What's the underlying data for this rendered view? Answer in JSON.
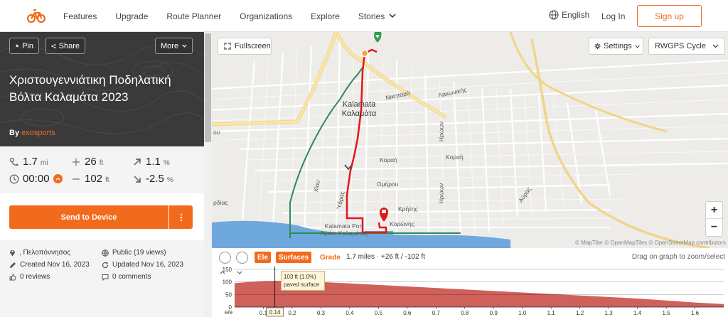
{
  "nav": {
    "links": [
      "Features",
      "Upgrade",
      "Route Planner",
      "Organizations",
      "Explore",
      "Stories"
    ],
    "language": "English",
    "login": "Log In",
    "signup": "Sign up",
    "accent": "#f26b1d"
  },
  "route": {
    "pin_label": "Pin",
    "share_label": "Share",
    "more_label": "More",
    "title": "Χριστουγεννιάτικη Ποδηλατική Βόλτα Καλαμάτα 2023",
    "by_label": "By",
    "author": "exosports"
  },
  "stats": {
    "distance": {
      "value": "1.7",
      "unit": "mi"
    },
    "elev_gain": {
      "value": "26",
      "unit": "ft"
    },
    "grade_up": {
      "value": "1.1",
      "unit": "%"
    },
    "time": {
      "value": "00:00"
    },
    "elev_loss": {
      "value": "102",
      "unit": "ft"
    },
    "grade_down": {
      "value": "-2.5",
      "unit": "%"
    }
  },
  "actions": {
    "send_to_device": "Send to Device"
  },
  "meta": {
    "location": ", Πελοπόννησος",
    "visibility": "Public (19 views)",
    "created": "Created Nov 16, 2023",
    "updated": "Updated Nov 16, 2023",
    "reviews": "0 reviews",
    "comments": "0 comments"
  },
  "map": {
    "fullscreen_label": "Fullscreen",
    "settings_label": "Settings",
    "map_style": "RWGPS Cycle",
    "zoom_in": "+",
    "zoom_out": "−",
    "attribution": "© MapTiler © OpenMapTiles © OpenStreetMap contributors",
    "labels": {
      "city": "Kalamata\nΚαλαμάτα",
      "nikitara": "Νικηταρά",
      "lakonikis": "Λακωνικής",
      "korai": "Κοραή",
      "korai2": "Κοραή",
      "omirou": "Ομήρου",
      "kritis": "Κρήτης",
      "koronis": "Κορώνης",
      "hroon": "Ηρώων",
      "hroon2": "Ηρώων",
      "xiou": "Χίου",
      "ydras": "Ύδρας",
      "avras": "Αύρας",
      "port": "Kalamata Port\nΛιμάνι Καλαμάτας",
      "edge_ou": "ου",
      "edge_rdias": "ρδίας"
    }
  },
  "elevation": {
    "ele_tab": "Ele",
    "surfaces_tab": "Surfaces",
    "grade_tab": "Grade",
    "summary": "1.7 miles · +26 ft / -102 ft",
    "drag_hint": "Drag on graph to zoom/select",
    "tooltip_line1": "103 ft (1.0%)",
    "tooltip_line2": "paved surface",
    "cursor_value": "0.14",
    "y_ticks": [
      "150",
      "100",
      "50",
      "0"
    ],
    "x_label": "e/e",
    "x_ticks": [
      "0.1",
      "0.2",
      "0.3",
      "0.4",
      "0.5",
      "0.6",
      "0.7",
      "0.8",
      "0.9",
      "1.0",
      "1.1",
      "1.2",
      "1.3",
      "1.4",
      "1.5",
      "1.6"
    ],
    "profile_color": "#d0605a"
  },
  "chart_data": {
    "type": "area",
    "xlabel": "",
    "ylabel": "",
    "ylim": [
      0,
      150
    ],
    "xlim": [
      0,
      1.7
    ],
    "series": [
      {
        "x": [
          0.0,
          0.05,
          0.1,
          0.15,
          0.2,
          0.3,
          0.4,
          0.5,
          0.6,
          0.7,
          0.8,
          0.9,
          1.0,
          1.1,
          1.2,
          1.3,
          1.4,
          1.5,
          1.6,
          1.7
        ],
        "values": [
          95,
          100,
          103,
          104,
          104,
          100,
          94,
          88,
          82,
          76,
          70,
          64,
          58,
          52,
          46,
          40,
          34,
          26,
          18,
          12
        ]
      }
    ]
  }
}
